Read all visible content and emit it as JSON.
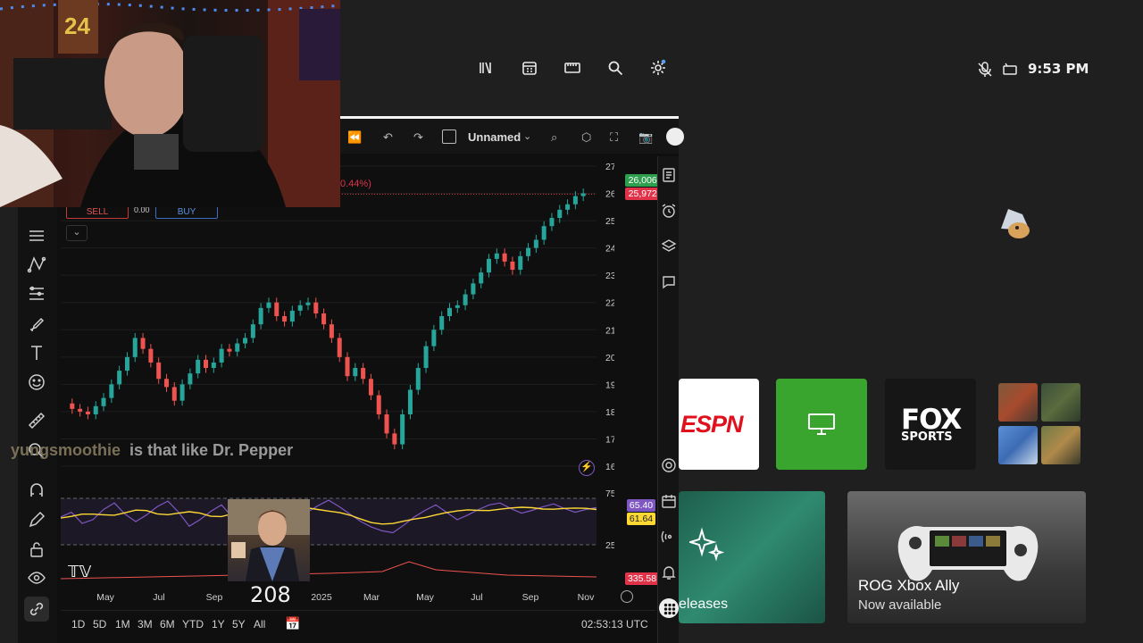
{
  "xbox": {
    "clock": "9:53 PM",
    "top_icons": [
      "library-icon",
      "store-icon",
      "game-pass-icon",
      "search-icon",
      "settings-icon"
    ],
    "status_icons": [
      "mic-muted-icon",
      "controller-battery-icon"
    ],
    "tiles": {
      "espn_label": "ESPN",
      "fox_line1": "FOX",
      "fox_line2": "SPORTS",
      "releases_label": "eleases",
      "rog_title": "ROG Xbox Ally",
      "rog_subtitle": "Now available"
    }
  },
  "tradingview": {
    "layout_name": "Unnamed",
    "sell_label": "SELL",
    "buy_label": "BUY",
    "sell_value": "0.00",
    "change_text": "0.44%)",
    "timeframes": [
      "1D",
      "5D",
      "1M",
      "3M",
      "6M",
      "YTD",
      "1Y",
      "5Y",
      "All"
    ],
    "time_utc": "02:53:13 UTC",
    "rsi_values": [
      "65.40",
      "61.64"
    ],
    "volume_value": "335.58",
    "price_tags": {
      "bid": "26,006.15",
      "last": "25,972.94"
    },
    "colors": {
      "up": "#26a69a",
      "down": "#ef5350",
      "rsi": "#7e57c2",
      "rsi_ma": "#fdd835",
      "bid": "#2e9e4f",
      "last": "#e0334a"
    }
  },
  "chart_data": {
    "type": "candlestick",
    "yticks": [
      "27,000.00",
      "26,000.00",
      "25,000.00",
      "24,000.00",
      "23,000.00",
      "22,000.00",
      "21,000.00",
      "20,000.00",
      "19,000.00",
      "18,000.00",
      "17,000.00",
      "16,000.00"
    ],
    "rsi_ticks": [
      "75.00",
      "25.00"
    ],
    "xticks": [
      "May",
      "Jul",
      "Sep",
      "2025",
      "Mar",
      "May",
      "Jul",
      "Sep",
      "Nov"
    ],
    "ylim": [
      16000,
      27000
    ],
    "close_series": [
      18300,
      18100,
      18000,
      17900,
      18200,
      18500,
      19000,
      19500,
      20000,
      20700,
      20300,
      19800,
      19200,
      18900,
      18400,
      19000,
      19400,
      19900,
      19600,
      19800,
      20300,
      20200,
      20500,
      20700,
      21200,
      21800,
      22000,
      21500,
      21300,
      21700,
      21900,
      22000,
      21600,
      21200,
      20700,
      20000,
      19300,
      19600,
      19200,
      18600,
      17900,
      17200,
      16800,
      17900,
      18800,
      19600,
      20400,
      21000,
      21500,
      21800,
      21900,
      22300,
      22700,
      23100,
      23600,
      23800,
      23500,
      23200,
      23700,
      24000,
      24300,
      24800,
      25100,
      25400,
      25600,
      25900,
      26000
    ],
    "rsi_series": [
      55,
      60,
      48,
      52,
      63,
      70,
      58,
      50,
      57,
      66,
      72,
      60,
      45,
      52,
      61,
      68,
      55,
      49,
      58,
      64,
      70,
      62,
      55,
      60,
      67,
      73,
      66,
      58,
      50,
      44,
      40,
      38,
      46,
      55,
      62,
      68,
      60,
      52,
      57,
      63,
      68,
      70,
      64,
      59,
      62,
      66,
      69,
      64,
      60,
      63,
      65
    ]
  },
  "stream": {
    "chat_user": "yungsmoothie",
    "chat_message": "is that like Dr. Pepper",
    "counter": "208"
  }
}
